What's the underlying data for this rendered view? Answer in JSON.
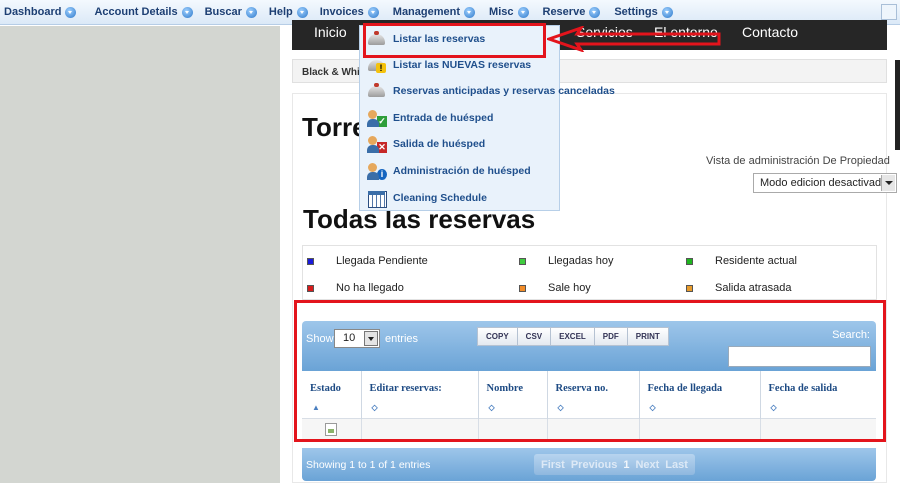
{
  "topbar": {
    "items": [
      {
        "label": "Dashboard"
      },
      {
        "label": "Account Details"
      },
      {
        "label": "Buscar"
      },
      {
        "label": "Help"
      },
      {
        "label": "Invoices"
      },
      {
        "label": "Management"
      },
      {
        "label": "Misc"
      },
      {
        "label": "Reserve"
      },
      {
        "label": "Settings"
      }
    ]
  },
  "sitenav": {
    "items": [
      "Inicio",
      "Servicios",
      "El entorno",
      "Contacto"
    ]
  },
  "breadcrumb": "Black & White",
  "page": {
    "partial_title": "Torre",
    "owner_view": "Vista de administración De Propiedad",
    "edit_mode": "Modo edicion desactivado",
    "title": "Todas las reservas"
  },
  "legend": [
    {
      "label": "Llegada Pendiente",
      "color": "#1a1adb"
    },
    {
      "label": "Llegadas hoy",
      "color": "#3fcc3f"
    },
    {
      "label": "Residente actual",
      "color": "#1fb51f"
    },
    {
      "label": "No ha llegado",
      "color": "#d81b1b"
    },
    {
      "label": "Sale hoy",
      "color": "#f28c28"
    },
    {
      "label": "Salida atrasada",
      "color": "#e89b2b"
    }
  ],
  "table": {
    "show_label": "Show",
    "length_value": "10",
    "entries_label": "entries",
    "buttons": [
      "COPY",
      "CSV",
      "EXCEL",
      "PDF",
      "PRINT"
    ],
    "search_label": "Search:",
    "columns": [
      "Estado",
      "Editar reservas:",
      "Nombre",
      "Reserva no.",
      "Fecha de llegada",
      "Fecha de salida"
    ],
    "info": "Showing 1 to 1 of 1 entries",
    "paging": [
      "First",
      "Previous",
      "1",
      "Next",
      "Last"
    ]
  },
  "dropdown": {
    "items": [
      {
        "label": "Listar las reservas",
        "icon": "bell-icon"
      },
      {
        "label": "Listar las NUEVAS reservas",
        "icon": "bell-warning-icon"
      },
      {
        "label": "Reservas anticipadas y reservas canceladas",
        "icon": "bell-lock-icon"
      },
      {
        "label": "Entrada de huésped",
        "icon": "guest-checkin-icon"
      },
      {
        "label": "Salida de huésped",
        "icon": "guest-checkout-icon"
      },
      {
        "label": "Administración de huésped",
        "icon": "guest-admin-icon"
      },
      {
        "label": "Cleaning Schedule",
        "icon": "calendar-icon"
      }
    ]
  },
  "colors": {
    "highlight": "#e3141c",
    "menu_text": "#1d3f73",
    "table_header": "#6aa3d6"
  }
}
